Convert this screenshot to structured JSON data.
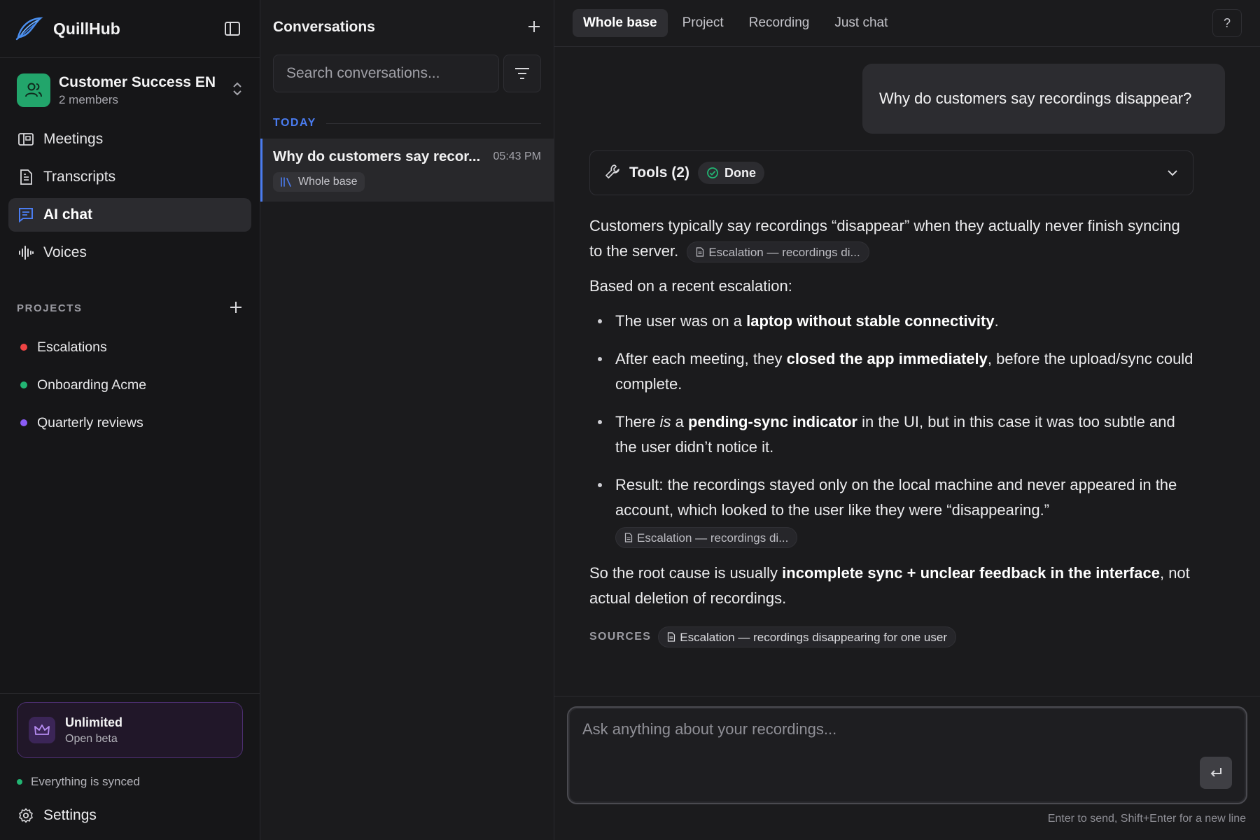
{
  "brand": {
    "name": "QuillHub"
  },
  "workspace": {
    "name": "Customer Success EN",
    "members": "2 members",
    "color": "#22a56b"
  },
  "nav": {
    "items": [
      {
        "label": "Meetings",
        "icon": "meetings-icon"
      },
      {
        "label": "Transcripts",
        "icon": "document-icon"
      },
      {
        "label": "AI chat",
        "icon": "chat-icon",
        "active": true
      },
      {
        "label": "Voices",
        "icon": "waveform-icon"
      }
    ]
  },
  "projects": {
    "title": "PROJECTS",
    "items": [
      {
        "label": "Escalations",
        "color": "#ef4444"
      },
      {
        "label": "Onboarding Acme",
        "color": "#22b573"
      },
      {
        "label": "Quarterly reviews",
        "color": "#8b5cf6"
      }
    ]
  },
  "plan": {
    "name": "Unlimited",
    "sub": "Open beta"
  },
  "sync": {
    "status": "Everything is synced"
  },
  "settings": {
    "label": "Settings"
  },
  "conversations": {
    "title": "Conversations",
    "search_placeholder": "Search conversations...",
    "section": "TODAY",
    "items": [
      {
        "title": "Why do customers say recor...",
        "time": "05:43 PM",
        "tag": "Whole base"
      }
    ]
  },
  "tabs": [
    "Whole base",
    "Project",
    "Recording",
    "Just chat"
  ],
  "active_tab": "Whole base",
  "help": "?",
  "chat": {
    "user_message": "Why do customers say recordings disappear?",
    "tools": {
      "label": "Tools (2)",
      "status": "Done"
    },
    "answer": {
      "p1": "Customers typically say recordings “disappear” when they actually never finish syncing to the server.",
      "chip_short": "Escalation — recordings di...",
      "p2": "Based on a recent escalation:",
      "b1_pre": "The user was on a ",
      "b1_bold": "laptop without stable connectivity",
      "b1_post": ".",
      "b2_pre": "After each meeting, they ",
      "b2_bold": "closed the app immediately",
      "b2_post": ", before the upload/sync could complete.",
      "b3_pre": "There ",
      "b3_em": "is",
      "b3_mid": " a ",
      "b3_bold": "pending-sync indicator",
      "b3_post": " in the UI, but in this case it was too subtle and the user didn’t notice it.",
      "b4": "Result: the recordings stayed only on the local machine and never appeared in the account, which looked to the user like they were “disappearing.”",
      "c_pre": "So the root cause is usually ",
      "c_bold": "incomplete sync + unclear feedback in the interface",
      "c_post": ", not actual deletion of recordings."
    },
    "sources": {
      "label": "SOURCES",
      "item": "Escalation — recordings disappearing for one user"
    }
  },
  "composer": {
    "placeholder": "Ask anything about your recordings...",
    "hint": "Enter to send, Shift+Enter for a new line"
  }
}
